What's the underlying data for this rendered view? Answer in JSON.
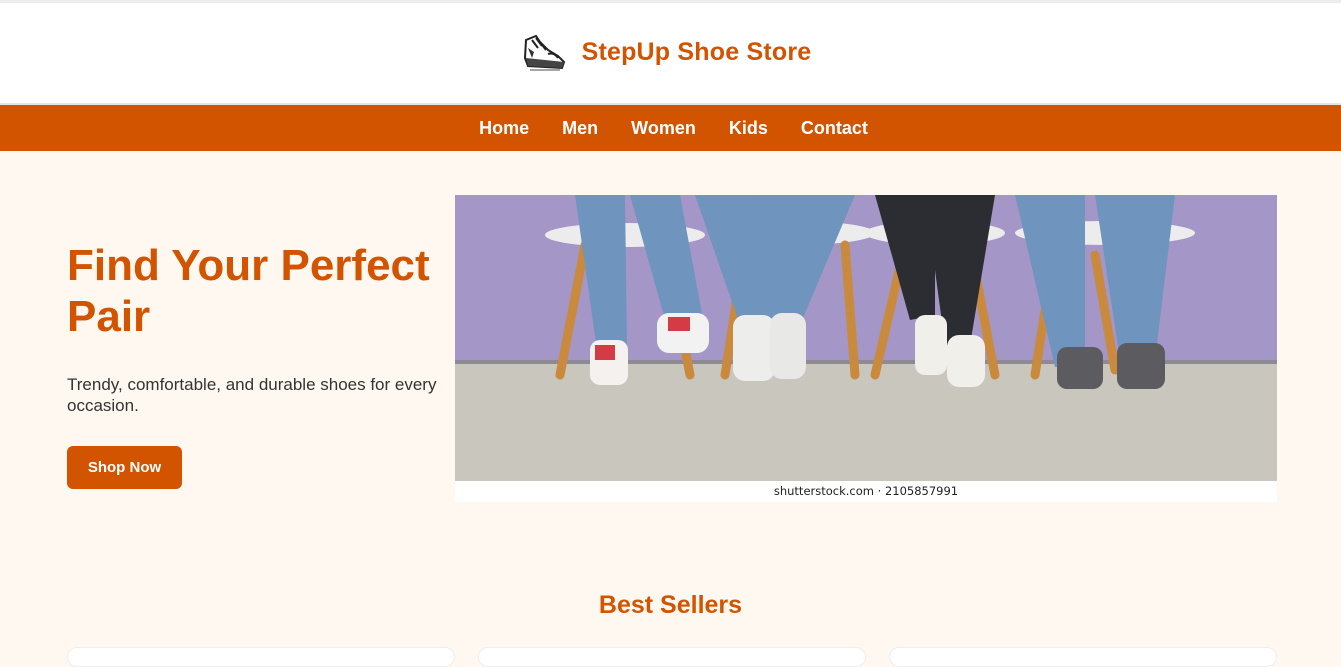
{
  "header": {
    "brand": "StepUp Shoe Store",
    "logo_icon": "sneaker-icon"
  },
  "nav": {
    "items": [
      "Home",
      "Men",
      "Women",
      "Kids",
      "Contact"
    ]
  },
  "hero": {
    "title": "Find Your Perfect Pair",
    "subtitle": "Trendy, comfortable, and durable shoes for every occasion.",
    "button": "Shop Now",
    "image_credit": "shutterstock.com · 2105857991"
  },
  "best_sellers": {
    "title": "Best Sellers"
  },
  "colors": {
    "accent": "#d35400",
    "background": "#fff8f1"
  }
}
